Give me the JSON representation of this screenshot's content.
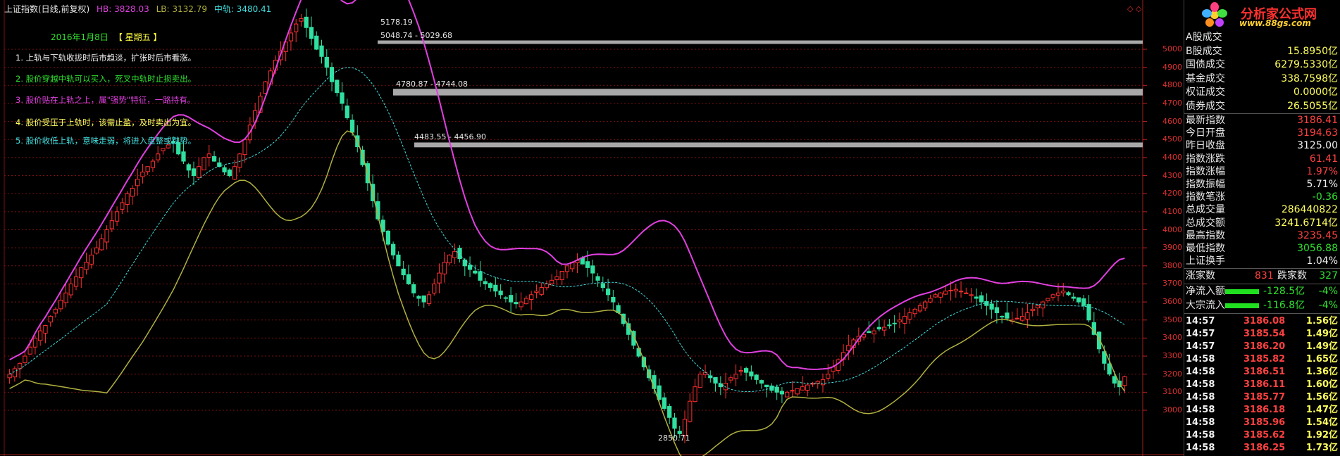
{
  "header": {
    "title": "上证指数(日线,前复权)",
    "hb": "HB: 3828.03",
    "lb": "LB: 3132.79",
    "mid": "中轨: 3480.41"
  },
  "date_line": {
    "date": "2016年1月8日",
    "week": "【 星期五 】"
  },
  "tips": [
    "1. 上轨与下轨收拢时后市趋淡，扩张时后市看涨。",
    "2. 股价穿越中轨可以买入，死叉中轨时止损卖出。",
    "3. 股价贴在上轨之上，属\"强势\"特征，一路持有。",
    "4. 股价受压于上轨时，该需止盈，及时卖出为宜。",
    "5. 股价收低上轨，意味走弱，将进入盘整或跌势。"
  ],
  "annotations": {
    "peak": "5178.19",
    "zone1": "5048.74 - 5029.68",
    "zone2": "4780.87 - 4744.08",
    "zone3": "4483.55 - 4456.90",
    "low": "2850.71"
  },
  "corner_icons": "◇ ◇",
  "chart_data": {
    "type": "candlestick",
    "title": "上证指数(日线,前复权)",
    "y_ticks": [
      3000,
      3100,
      3200,
      3300,
      3400,
      3500,
      3600,
      3700,
      3800,
      3900,
      4000,
      4100,
      4200,
      4300,
      4400,
      4500,
      4600,
      4700,
      4800,
      4900,
      5000
    ],
    "ylim": [
      2800,
      5200
    ],
    "zones": [
      {
        "from": 5029.68,
        "to": 5048.74,
        "label": "5048.74 - 5029.68"
      },
      {
        "from": 4744.08,
        "to": 4780.87,
        "label": "4780.87 - 4744.08"
      },
      {
        "from": 4456.9,
        "to": 4483.55,
        "label": "4483.55 - 4456.90"
      }
    ],
    "series": [
      {
        "name": "HB",
        "color": "#e040e0"
      },
      {
        "name": "LB",
        "color": "#b0b040"
      },
      {
        "name": "中轨",
        "color": "#40e0e0"
      }
    ],
    "close": [
      3200,
      3230,
      3260,
      3300,
      3350,
      3400,
      3440,
      3470,
      3520,
      3560,
      3610,
      3650,
      3700,
      3740,
      3790,
      3820,
      3860,
      3900,
      3950,
      4000,
      4050,
      4100,
      4150,
      4200,
      4230,
      4280,
      4320,
      4350,
      4380,
      4420,
      4450,
      4470,
      4480,
      4420,
      4380,
      4330,
      4300,
      4350,
      4400,
      4420,
      4380,
      4350,
      4320,
      4300,
      4350,
      4420,
      4500,
      4580,
      4660,
      4740,
      4820,
      4880,
      4940,
      4990,
      5040,
      5090,
      5140,
      5170,
      5120,
      5060,
      5000,
      4960,
      4900,
      4820,
      4760,
      4700,
      4620,
      4540,
      4460,
      4360,
      4260,
      4160,
      4060,
      3990,
      3920,
      3860,
      3800,
      3750,
      3700,
      3650,
      3620,
      3600,
      3640,
      3700,
      3760,
      3820,
      3860,
      3880,
      3840,
      3800,
      3780,
      3760,
      3720,
      3700,
      3680,
      3660,
      3640,
      3620,
      3600,
      3590,
      3600,
      3620,
      3640,
      3660,
      3680,
      3700,
      3720,
      3740,
      3770,
      3800,
      3820,
      3830,
      3810,
      3790,
      3760,
      3720,
      3680,
      3640,
      3600,
      3540,
      3480,
      3420,
      3360,
      3300,
      3240,
      3180,
      3120,
      3060,
      3010,
      2960,
      2900,
      2870,
      2950,
      3050,
      3130,
      3200,
      3210,
      3180,
      3150,
      3130,
      3150,
      3180,
      3200,
      3220,
      3210,
      3190,
      3170,
      3150,
      3130,
      3110,
      3100,
      3090,
      3100,
      3110,
      3120,
      3130,
      3140,
      3150,
      3160,
      3170,
      3200,
      3240,
      3280,
      3320,
      3360,
      3390,
      3410,
      3420,
      3430,
      3440,
      3450,
      3460,
      3470,
      3480,
      3500,
      3520,
      3540,
      3560,
      3580,
      3600,
      3620,
      3640,
      3650,
      3660,
      3665,
      3670,
      3660,
      3650,
      3640,
      3620,
      3600,
      3580,
      3560,
      3540,
      3520,
      3510,
      3500,
      3510,
      3520,
      3540,
      3560,
      3580,
      3600,
      3620,
      3640,
      3650,
      3660,
      3640,
      3620,
      3600,
      3580,
      3500,
      3420,
      3340,
      3260,
      3200,
      3150,
      3130,
      3186
    ]
  },
  "panel": {
    "logo_text": "分析家公式网",
    "logo_url": "www.88gs.com",
    "top_rows": [
      {
        "label": "A股成交",
        "value": ""
      },
      {
        "label": "B股成交",
        "value": "15.8950亿"
      },
      {
        "label": "国债成交",
        "value": "6279.5330亿"
      },
      {
        "label": "基金成交",
        "value": "338.7598亿"
      },
      {
        "label": "权证成交",
        "value": "0.0000亿"
      },
      {
        "label": "债券成交",
        "value": "26.5055亿"
      }
    ],
    "index_rows": [
      {
        "label": "最新指数",
        "value": "3186.41",
        "color": "red"
      },
      {
        "label": "今日开盘",
        "value": "3194.63",
        "color": "red"
      },
      {
        "label": "昨日收盘",
        "value": "3125.00",
        "color": "white"
      },
      {
        "label": "指数涨跌",
        "value": "61.41",
        "color": "red"
      },
      {
        "label": "指数涨幅",
        "value": "1.97%",
        "color": "red"
      },
      {
        "label": "指数振幅",
        "value": "5.71%",
        "color": "white"
      },
      {
        "label": "指数笔涨",
        "value": "-0.36",
        "color": "green"
      },
      {
        "label": "总成交量",
        "value": "286440822",
        "color": "yellow"
      },
      {
        "label": "总成交额",
        "value": "3241.6714亿",
        "color": "yellow"
      },
      {
        "label": "最高指数",
        "value": "3235.45",
        "color": "red"
      },
      {
        "label": "最低指数",
        "value": "3056.88",
        "color": "green"
      },
      {
        "label": "上证换手",
        "value": "1.04%",
        "color": "white"
      }
    ],
    "updown": {
      "up_label": "涨家数",
      "up_value": "831",
      "down_label": "跌家数",
      "down_value": "327"
    },
    "flows": [
      {
        "label": "净流入额",
        "value": "-128.5亿",
        "pct": "-4%"
      },
      {
        "label": "大宗流入",
        "value": "-116.8亿",
        "pct": "-4%"
      }
    ],
    "ticks": [
      {
        "time": "14:57",
        "price": "3186.08",
        "vol": "1.56亿"
      },
      {
        "time": "14:57",
        "price": "3185.54",
        "vol": "1.49亿"
      },
      {
        "time": "14:57",
        "price": "3186.20",
        "vol": "1.49亿"
      },
      {
        "time": "14:58",
        "price": "3185.82",
        "vol": "1.65亿"
      },
      {
        "time": "14:58",
        "price": "3186.51",
        "vol": "1.36亿"
      },
      {
        "time": "14:58",
        "price": "3186.11",
        "vol": "1.60亿"
      },
      {
        "time": "14:58",
        "price": "3185.77",
        "vol": "1.56亿"
      },
      {
        "time": "14:58",
        "price": "3186.18",
        "vol": "1.47亿"
      },
      {
        "time": "14:58",
        "price": "3185.96",
        "vol": "1.54亿"
      },
      {
        "time": "14:58",
        "price": "3185.62",
        "vol": "1.92亿"
      },
      {
        "time": "14:58",
        "price": "3186.25",
        "vol": "1.73亿"
      }
    ]
  },
  "colors": {
    "up": "#ff3030",
    "down": "#30e0a0",
    "grid": "#7a1010",
    "zone": "#a8a8a8"
  }
}
